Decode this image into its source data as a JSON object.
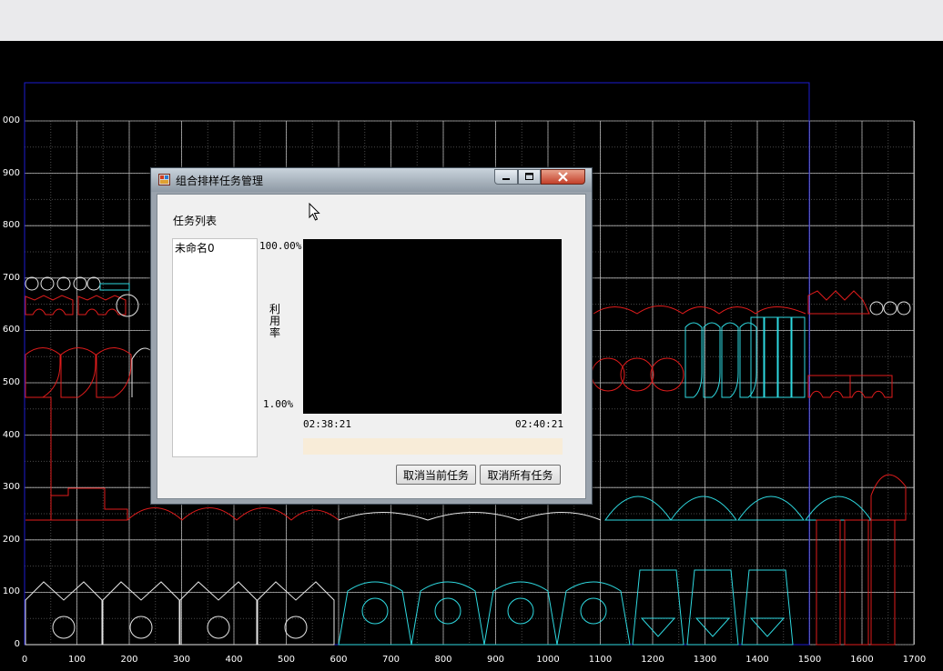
{
  "plot": {
    "y_ticks": [
      "0",
      "100",
      "200",
      "300",
      "400",
      "500",
      "600",
      "700",
      "800",
      "900",
      "000"
    ],
    "x_ticks": [
      "0",
      "100",
      "200",
      "300",
      "400",
      "500",
      "600",
      "700",
      "800",
      "900",
      "1000",
      "1100",
      "1200",
      "1300",
      "1400",
      "1500",
      "1600",
      "1700"
    ]
  },
  "dialog": {
    "title": "组合排样任务管理",
    "task_list_label": "任务列表",
    "tasks": [
      "未命名0"
    ],
    "chart_y_max": "100.00%",
    "chart_y_min": "1.00%",
    "chart_y_label": "利用率",
    "time_start": "02:38:21",
    "time_end": "02:40:21",
    "progress": 0,
    "cancel_current_label": "取消当前任务",
    "cancel_all_label": "取消所有任务"
  },
  "colors": {
    "background": "#000000",
    "grid": "#b4b4b4",
    "boundary": "#1c1cd0",
    "part_red": "#e01c1c",
    "part_cyan": "#2ed9e0",
    "part_white": "#e6e6e6"
  },
  "icons": [
    "app-icon",
    "minimize-icon",
    "maximize-icon",
    "close-icon",
    "mouse-cursor-icon"
  ]
}
